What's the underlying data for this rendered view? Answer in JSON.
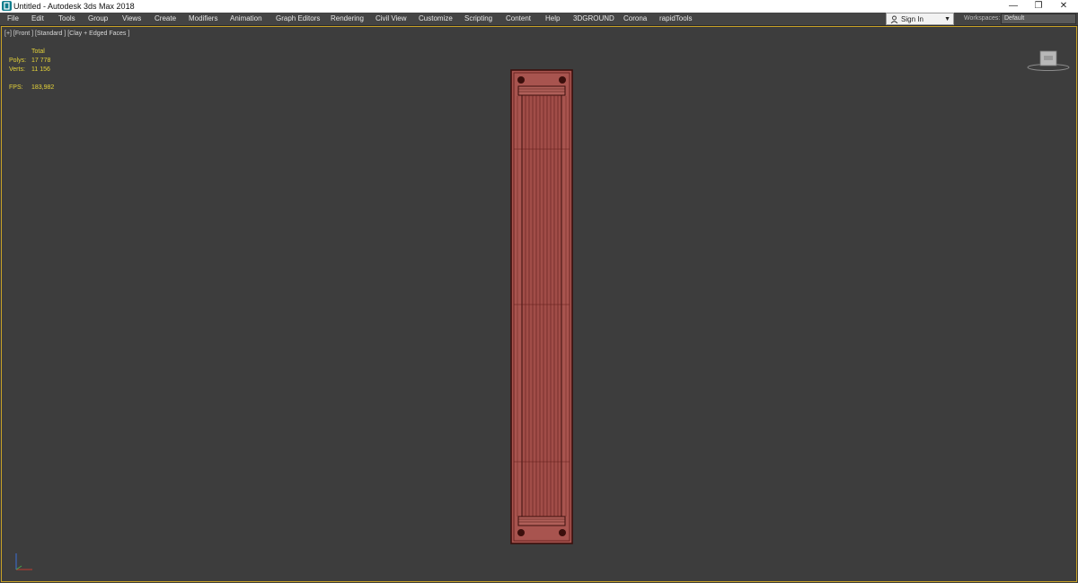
{
  "window": {
    "title": "Untitled - Autodesk 3ds Max 2018",
    "controls": {
      "minimize": "—",
      "maximize": "❐",
      "close": "✕"
    }
  },
  "menu": {
    "items": [
      "File",
      "Edit",
      "Tools",
      "Group",
      "Views",
      "Create",
      "Modifiers",
      "Animation",
      "Graph Editors",
      "Rendering",
      "Civil View",
      "Customize",
      "Scripting",
      "Content",
      "Help",
      "3DGROUND",
      "Corona",
      "rapidTools"
    ]
  },
  "account": {
    "sign_in": "Sign In"
  },
  "workspaces": {
    "label": "Workspaces:",
    "value": "Default"
  },
  "viewport": {
    "label": "[+] [Front ] [Standard ] [Clay + Edged Faces ]",
    "stats": {
      "total_label": "Total",
      "polys_label": "Polys:",
      "polys_value": "17 778",
      "verts_label": "Verts:",
      "verts_value": "11 156",
      "fps_label": "FPS:",
      "fps_value": "183,982"
    }
  },
  "colors": {
    "viewport_bg": "#3d3d3d",
    "active_border": "#c9a227",
    "stats_text": "#e5d33a",
    "clay_red": "#a8544f",
    "edge_dark": "#3b0f0c"
  },
  "icons": {
    "app": "3dsmax-app-icon",
    "user": "user-icon",
    "caret": "caret-down-icon",
    "viewcube": "viewcube-icon",
    "tripod": "axis-tripod-icon"
  }
}
